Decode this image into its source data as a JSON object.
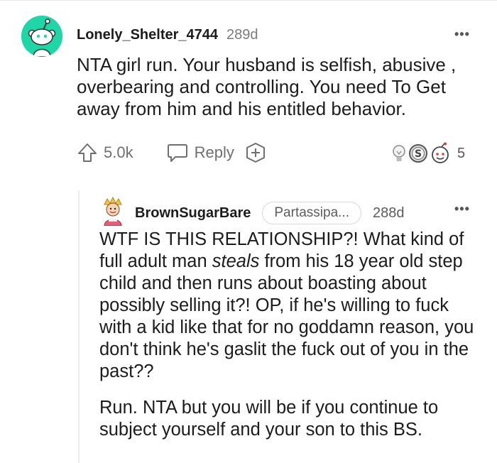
{
  "comment": {
    "username": "Lonely_Shelter_4744",
    "age": "289d",
    "text": "NTA girl run. Your husband is selfish, abusive , overbearing and controlling. You need To Get away from him and his entitled behavior.",
    "upvotes": "5.0k",
    "reply_label": "Reply",
    "award_count": "5",
    "more": "•••"
  },
  "reply": {
    "username": "BrownSugarBare",
    "flair": "Partassipa...",
    "age": "288d",
    "more": "•••",
    "p1_before": "WTF IS THIS RELATIONSHIP?! What kind of full adult man ",
    "p1_em": "steals",
    "p1_after": " from his 18 year old step child and then runs about boasting about possibly selling it?! OP, if he's willing to fuck with a kid like that for no goddamn reason, you don't think he's gaslit the fuck out of you in the past??",
    "p2": "Run. NTA but you will be if you continue to subject yourself and your son to this BS."
  },
  "colors": {
    "avatar_bg": "#1fd6a6",
    "muted": "#6f6f6f"
  },
  "icons": [
    "reddit-snoo-avatar",
    "upvote-arrow-icon",
    "speech-bubble-icon",
    "add-award-icon",
    "lightbulb-award-icon",
    "silver-award-icon",
    "wholesome-award-icon"
  ]
}
